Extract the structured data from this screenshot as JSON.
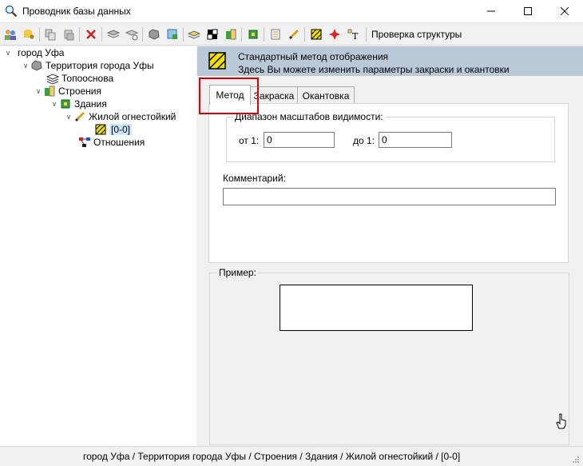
{
  "window": {
    "title": "Проводник базы данных"
  },
  "toolbar": {
    "check_structure_label": "Проверка структуры"
  },
  "tree": {
    "items": [
      {
        "label": "город Уфа"
      },
      {
        "label": "Территория города Уфы"
      },
      {
        "label": "Топооснова"
      },
      {
        "label": "Строения"
      },
      {
        "label": "Здания"
      },
      {
        "label": "Жилой огнестойкий"
      },
      {
        "label": "[0-0]"
      },
      {
        "label": "Отношения"
      }
    ]
  },
  "header": {
    "title": "Стандартный метод отображения",
    "subtitle": "Здесь Вы можете изменить параметры закраски и окантовки"
  },
  "tabs": [
    {
      "label": "Метод"
    },
    {
      "label": "Закраска"
    },
    {
      "label": "Окантовка"
    }
  ],
  "method": {
    "scale_group_label": "Диапазон масштабов видимости:",
    "from_label": "от 1:",
    "from_value": "0",
    "to_label": "до 1:",
    "to_value": "0",
    "comment_label": "Комментарий:",
    "comment_value": ""
  },
  "preview": {
    "label": "Пример:"
  },
  "statusbar": {
    "path": "город Уфа / Территория города Уфы / Строения / Здания / Жилой огнестойкий / [0-0]"
  },
  "colors": {
    "header_band": "#b9c9d8",
    "highlight": "#e00000",
    "selection": "#cce8ff"
  }
}
